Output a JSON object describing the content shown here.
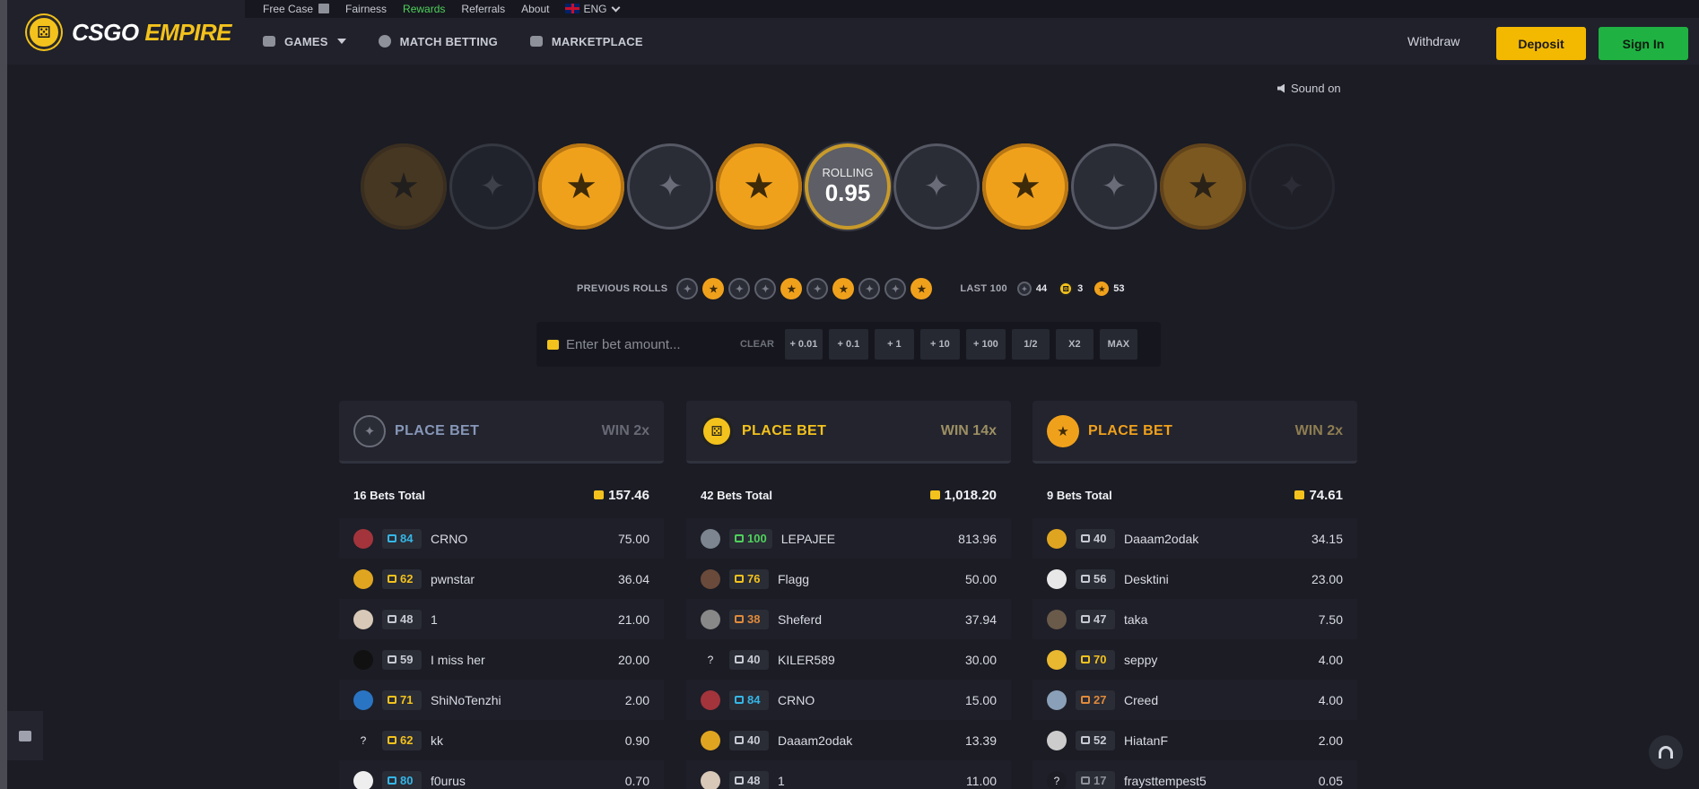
{
  "brand": {
    "logo_text_1": "CSGO",
    "logo_text_2": "EMPIRE",
    "accent": "#f3c21c"
  },
  "topbar": {
    "free_case": "Free Case",
    "fairness": "Fairness",
    "rewards": "Rewards",
    "referrals": "Referrals",
    "about": "About",
    "language": "ENG"
  },
  "nav": {
    "games": "GAMES",
    "match_betting": "MATCH BETTING",
    "marketplace": "MARKETPLACE",
    "withdraw": "Withdraw",
    "deposit": "Deposit",
    "sign_in": "Sign In"
  },
  "sound": "Sound on",
  "roller": {
    "coins": [
      "t",
      "ct",
      "t",
      "ct",
      "t",
      "roll",
      "ct",
      "t",
      "ct",
      "t",
      "ct"
    ],
    "rolling_label": "ROLLING",
    "rolling_value": "0.95"
  },
  "previous": {
    "label": "PREVIOUS ROLLS",
    "rolls": [
      "ct",
      "t",
      "ct",
      "ct",
      "t",
      "ct",
      "t",
      "ct",
      "ct",
      "t"
    ],
    "last100_label": "LAST 100",
    "ct_count": "44",
    "dice_count": "3",
    "t_count": "53"
  },
  "bet": {
    "placeholder": "Enter bet amount...",
    "clear": "CLEAR",
    "chips": [
      "+ 0.01",
      "+ 0.1",
      "+ 1",
      "+ 10",
      "+ 100",
      "1/2",
      "X2",
      "MAX"
    ]
  },
  "columns": [
    {
      "side": "ct",
      "title": "PLACE BET",
      "win": "WIN 2x",
      "bets_total": "16 Bets Total",
      "sum": "157.46",
      "rows": [
        {
          "avatar": "#a3343c",
          "level": "84",
          "level_color": "#35b6e6",
          "name": "CRNO",
          "amount": "75.00"
        },
        {
          "avatar": "#e0a520",
          "level": "62",
          "level_color": "#f3c21c",
          "name": "pwnstar",
          "amount": "36.04"
        },
        {
          "avatar": "#d8c8b8",
          "level": "48",
          "level_color": "#c8cad3",
          "name": "1",
          "amount": "21.00"
        },
        {
          "avatar": "#111111",
          "level": "59",
          "level_color": "#c8cad3",
          "name": "I miss her",
          "amount": "20.00"
        },
        {
          "avatar": "#2a74c4",
          "level": "71",
          "level_color": "#f3c21c",
          "name": "ShiNoTenzhi",
          "amount": "2.00"
        },
        {
          "avatar": "#1b1c24",
          "level": "62",
          "level_color": "#f3c21c",
          "name": "kk",
          "amount": "0.90",
          "unknown": true
        },
        {
          "avatar": "#eeeeee",
          "level": "80",
          "level_color": "#35b6e6",
          "name": "f0urus",
          "amount": "0.70"
        }
      ]
    },
    {
      "side": "dice",
      "title": "PLACE BET",
      "win": "WIN 14x",
      "bets_total": "42 Bets Total",
      "sum": "1,018.20",
      "rows": [
        {
          "avatar": "#7c8590",
          "level": "100",
          "level_color": "#4fd15b",
          "name": "LEPAJEE",
          "amount": "813.96"
        },
        {
          "avatar": "#6a4a3a",
          "level": "76",
          "level_color": "#f3c21c",
          "name": "Flagg",
          "amount": "50.00"
        },
        {
          "avatar": "#888888",
          "level": "38",
          "level_color": "#e08a3a",
          "name": "Sheferd",
          "amount": "37.94"
        },
        {
          "avatar": "#1b1c24",
          "level": "40",
          "level_color": "#c8cad3",
          "name": "KILER589",
          "amount": "30.00",
          "unknown": true
        },
        {
          "avatar": "#a3343c",
          "level": "84",
          "level_color": "#35b6e6",
          "name": "CRNO",
          "amount": "15.00"
        },
        {
          "avatar": "#e0a520",
          "level": "40",
          "level_color": "#c8cad3",
          "name": "Daaam2odak",
          "amount": "13.39"
        },
        {
          "avatar": "#d8c8b8",
          "level": "48",
          "level_color": "#c8cad3",
          "name": "1",
          "amount": "11.00"
        }
      ]
    },
    {
      "side": "t",
      "title": "PLACE BET",
      "win": "WIN 2x",
      "bets_total": "9 Bets Total",
      "sum": "74.61",
      "rows": [
        {
          "avatar": "#e0a520",
          "level": "40",
          "level_color": "#c8cad3",
          "name": "Daaam2odak",
          "amount": "34.15"
        },
        {
          "avatar": "#e8e8e8",
          "level": "56",
          "level_color": "#c8cad3",
          "name": "Desktini",
          "amount": "23.00"
        },
        {
          "avatar": "#6a5a4a",
          "level": "47",
          "level_color": "#c8cad3",
          "name": "taka",
          "amount": "7.50"
        },
        {
          "avatar": "#e8b830",
          "level": "70",
          "level_color": "#f3c21c",
          "name": "seppy",
          "amount": "4.00"
        },
        {
          "avatar": "#8aa0b8",
          "level": "27",
          "level_color": "#e08a3a",
          "name": "Creed",
          "amount": "4.00"
        },
        {
          "avatar": "#cccccc",
          "level": "52",
          "level_color": "#c8cad3",
          "name": "HiatanF",
          "amount": "2.00"
        },
        {
          "avatar": "#1b1c24",
          "level": "17",
          "level_color": "#8e909a",
          "name": "fraysttempest5",
          "amount": "0.05",
          "unknown": true
        }
      ]
    }
  ]
}
